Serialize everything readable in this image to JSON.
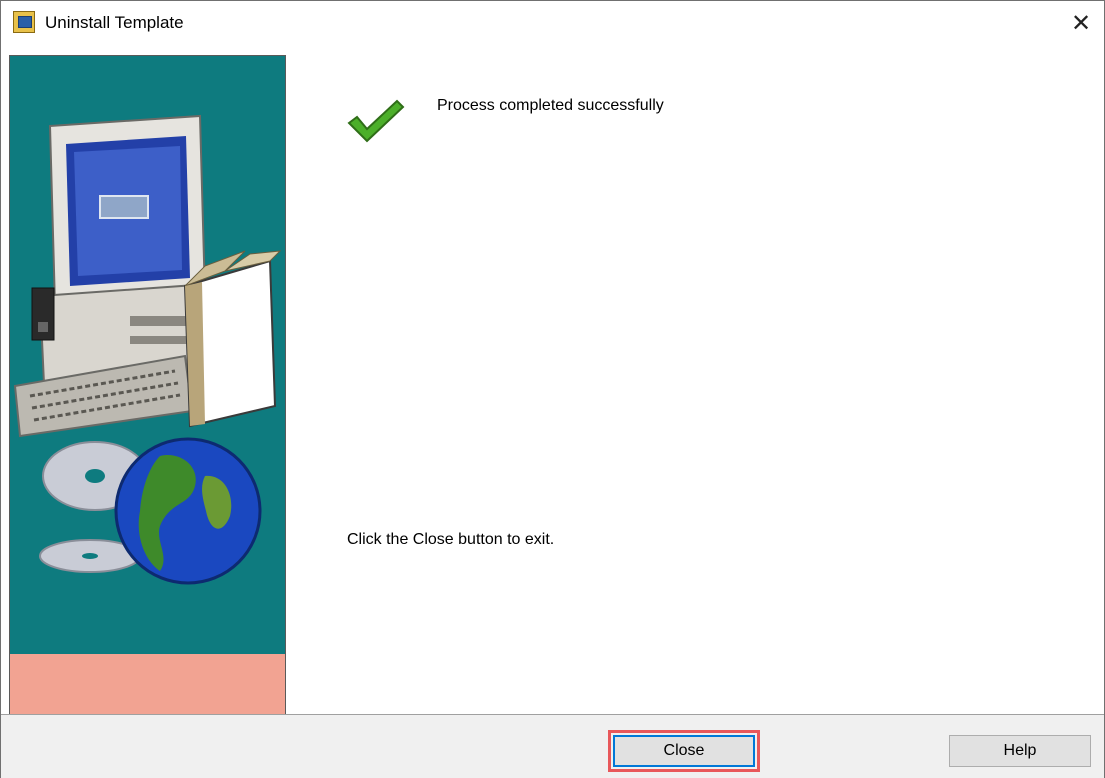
{
  "window": {
    "title": "Uninstall Template",
    "app_icon": "installer-app-icon",
    "close_glyph": "✕"
  },
  "side_panel": {
    "art": "computer-cds-globe-illustration",
    "accent_top": "#0e7b7f",
    "accent_bottom": "#f2a392"
  },
  "content": {
    "status_icon": "checkmark-icon",
    "status_message": "Process completed successfully",
    "exit_hint": "Click the Close button to exit."
  },
  "buttons": {
    "close_label": "Close",
    "help_label": "Help"
  },
  "colors": {
    "focus_highlight": "#e8575a",
    "default_button_border": "#0078d7",
    "check_green": "#4caf2a"
  }
}
